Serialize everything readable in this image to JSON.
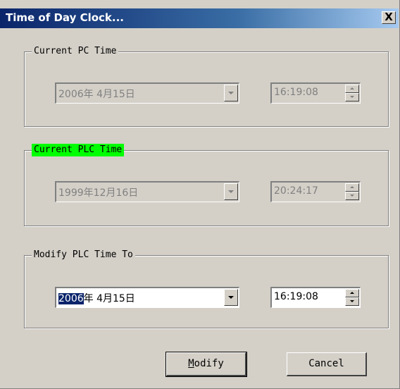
{
  "window": {
    "title": "Time of Day Clock...",
    "close_label": "X"
  },
  "current_pc": {
    "label": "Current PC Time",
    "date": "2006年 4月15日",
    "time": "16:19:08"
  },
  "current_plc": {
    "label": "Current PLC Time",
    "label_highlight_color": "#00ff00",
    "date": "1999年12月16日",
    "time": "20:24:17"
  },
  "modify_plc": {
    "label": "Modify PLC Time To",
    "date_selected_part": "2006",
    "date_rest": "年 4月15日",
    "time": "16:19:08"
  },
  "buttons": {
    "modify_accel": "M",
    "modify_rest": "odify",
    "cancel": "Cancel"
  },
  "colors": {
    "titlebar_start": "#0a246a",
    "titlebar_end": "#a6caf0",
    "dialog_bg": "#d4d0c8",
    "selection": "#0a246a"
  },
  "icons": [
    "close-icon",
    "dropdown-arrow-icon",
    "spin-up-icon",
    "spin-down-icon"
  ]
}
